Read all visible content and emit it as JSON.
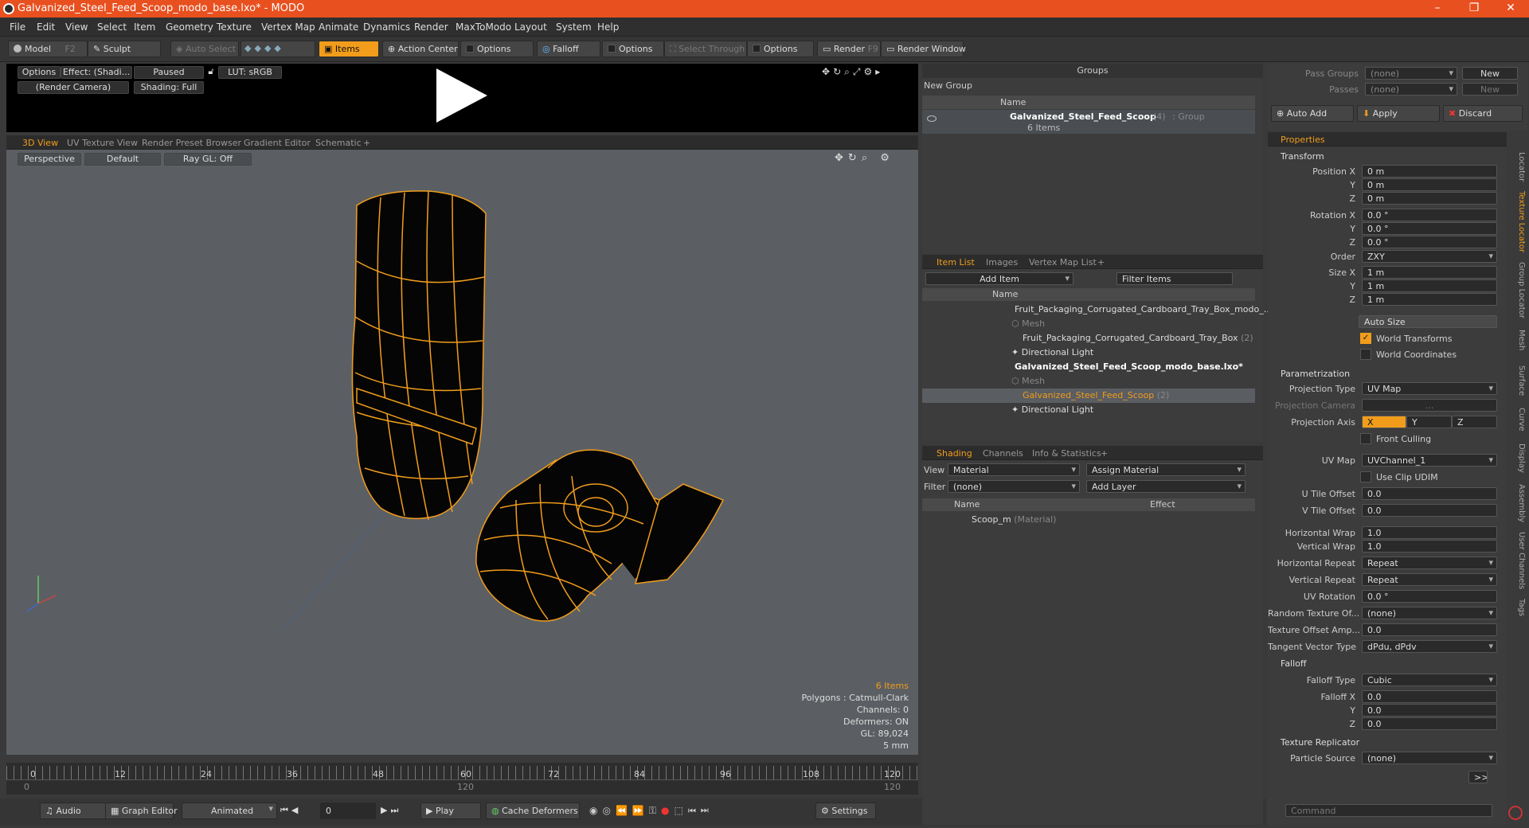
{
  "window": {
    "title": "Galvanized_Steel_Feed_Scoop_modo_base.lxo* - MODO",
    "minimize": "–",
    "maximize": "❐",
    "close": "✕"
  },
  "menu": [
    "File",
    "Edit",
    "View",
    "Select",
    "Item",
    "Geometry",
    "Texture",
    "Vertex Map",
    "Animate",
    "Dynamics",
    "Render",
    "MaxToModo",
    "Layout",
    "System",
    "Help"
  ],
  "toolbar": {
    "model": "Model",
    "model_key": "F2",
    "sculpt": "Sculpt",
    "auto_select": "Auto Select",
    "items": "Items",
    "action_center": "Action Center",
    "options1": "Options",
    "falloff": "Falloff",
    "options2": "Options",
    "select_through": "Select Through",
    "options3": "Options",
    "render": "Render",
    "render_key": "F9",
    "render_window": "Render Window"
  },
  "preview": {
    "options": "Options",
    "effect": "Effect: (Shadi...",
    "paused": "Paused",
    "lut": "LUT: sRGB",
    "camera": "(Render Camera)",
    "shading": "Shading: Full"
  },
  "viewport_tabs": [
    "3D View",
    "UV Texture View",
    "Render Preset Browser",
    "Gradient Editor",
    "Schematic",
    "+"
  ],
  "viewport": {
    "perspective": "Perspective",
    "default": "Default",
    "raygl": "Ray GL: Off"
  },
  "stats": {
    "items": "6 Items",
    "polygons": "Polygons : Catmull-Clark",
    "channels": "Channels: 0",
    "deformers": "Deformers: ON",
    "gl": "GL: 89,024",
    "size": "5 mm"
  },
  "timeline": {
    "ticks": [
      "0",
      "12",
      "24",
      "36",
      "48",
      "60",
      "72",
      "84",
      "96",
      "108",
      "120"
    ],
    "sub_start": "0",
    "sub_mid": "120",
    "sub_end": "120"
  },
  "bottom": {
    "audio": "Audio",
    "graph_editor": "Graph Editor",
    "animated": "Animated",
    "frame": "0",
    "play": "Play",
    "cache": "Cache Deformers",
    "settings": "Settings"
  },
  "groups": {
    "title": "Groups",
    "new_group": "New Group",
    "col_name": "Name",
    "item_name": "Galvanized_Steel_Feed_Scoop",
    "item_count": "(4)",
    "item_type": ": Group",
    "item_sub": "6 Items"
  },
  "itemlist": {
    "tabs": [
      "Item List",
      "Images",
      "Vertex Map List",
      "+"
    ],
    "add_item": "Add Item",
    "filter": "Filter Items",
    "col_name": "Name",
    "rows": [
      {
        "label": "Fruit_Packaging_Corrugated_Cardboard_Tray_Box_modo_...",
        "extra": ""
      },
      {
        "label": "Mesh",
        "extra": ""
      },
      {
        "label": "Fruit_Packaging_Corrugated_Cardboard_Tray_Box",
        "extra": "(2)"
      },
      {
        "label": "Directional Light",
        "extra": ""
      },
      {
        "label": "Galvanized_Steel_Feed_Scoop_modo_base.lxo*",
        "extra": ""
      },
      {
        "label": "Mesh",
        "extra": ""
      },
      {
        "label": "Galvanized_Steel_Feed_Scoop",
        "extra": "(2)"
      },
      {
        "label": "Directional Light",
        "extra": ""
      }
    ]
  },
  "shading": {
    "tabs": [
      "Shading",
      "Channels",
      "Info & Statistics",
      "+"
    ],
    "view_label": "View",
    "view_value": "Material",
    "assign": "Assign Material",
    "filter_label": "Filter",
    "filter_value": "(none)",
    "add_layer": "Add Layer",
    "col_name": "Name",
    "col_effect": "Effect",
    "item": "Scoop_m",
    "item_type": "(Material)"
  },
  "passes": {
    "pass_groups": "Pass Groups",
    "passes": "Passes",
    "none1": "(none)",
    "none2": "(none)",
    "new1": "New",
    "new2": "New"
  },
  "actions": {
    "auto_add": "Auto Add",
    "apply": "Apply",
    "discard": "Discard"
  },
  "properties": {
    "tab": "Properties",
    "transform": "Transform",
    "pos_x": "0 m",
    "pos_y": "0 m",
    "pos_z": "0 m",
    "rot_x": "0.0 °",
    "rot_y": "0.0 °",
    "rot_z": "0.0 °",
    "order": "ZXY",
    "size_x": "1 m",
    "size_y": "1 m",
    "size_z": "1 m",
    "auto_size": "Auto Size",
    "world_transforms": "World Transforms",
    "world_coords": "World Coordinates",
    "parametrization": "Parametrization",
    "projection_type": "UV Map",
    "projection_camera": "...",
    "axis_x": "X",
    "axis_y": "Y",
    "axis_z": "Z",
    "front_culling": "Front Culling",
    "uv_map": "UVChannel_1",
    "use_clip_udim": "Use Clip UDIM",
    "u_tile": "0.0",
    "v_tile": "0.0",
    "h_wrap": "1.0",
    "v_wrap": "1.0",
    "h_repeat": "Repeat",
    "v_repeat": "Repeat",
    "uv_rotation": "0.0 °",
    "random_tex": "(none)",
    "tex_offset_amp": "0.0",
    "tangent": "dPdu, dPdv",
    "falloff": "Falloff",
    "falloff_type": "Cubic",
    "falloff_x": "0.0",
    "falloff_y": "0.0",
    "falloff_z": "0.0",
    "replicator": "Texture Replicator",
    "particle_source": "(none)",
    "more": ">>"
  },
  "labels": {
    "position_x": "Position X",
    "y": "Y",
    "z": "Z",
    "rotation_x": "Rotation X",
    "order": "Order",
    "size_x": "Size X",
    "projection_type": "Projection Type",
    "projection_camera": "Projection Camera",
    "projection_axis": "Projection Axis",
    "uv_map": "UV Map",
    "u_tile": "U Tile Offset",
    "v_tile": "V Tile Offset",
    "h_wrap": "Horizontal Wrap",
    "v_wrap": "Vertical Wrap",
    "h_repeat": "Horizontal Repeat",
    "v_repeat": "Vertical Repeat",
    "uv_rotation": "UV Rotation",
    "random_tex": "Random Texture Of...",
    "tex_offset_amp": "Texture Offset Amp...",
    "tangent": "Tangent Vector Type",
    "falloff_type": "Falloff Type",
    "falloff_x": "Falloff X",
    "particle_source": "Particle Source"
  },
  "side_tabs": [
    "Locator",
    "Texture Locator",
    "Group Locator",
    "Mesh",
    "Surface",
    "Curve",
    "Display",
    "Assembly",
    "User Channels",
    "Tags"
  ],
  "command": {
    "placeholder": "Command"
  }
}
